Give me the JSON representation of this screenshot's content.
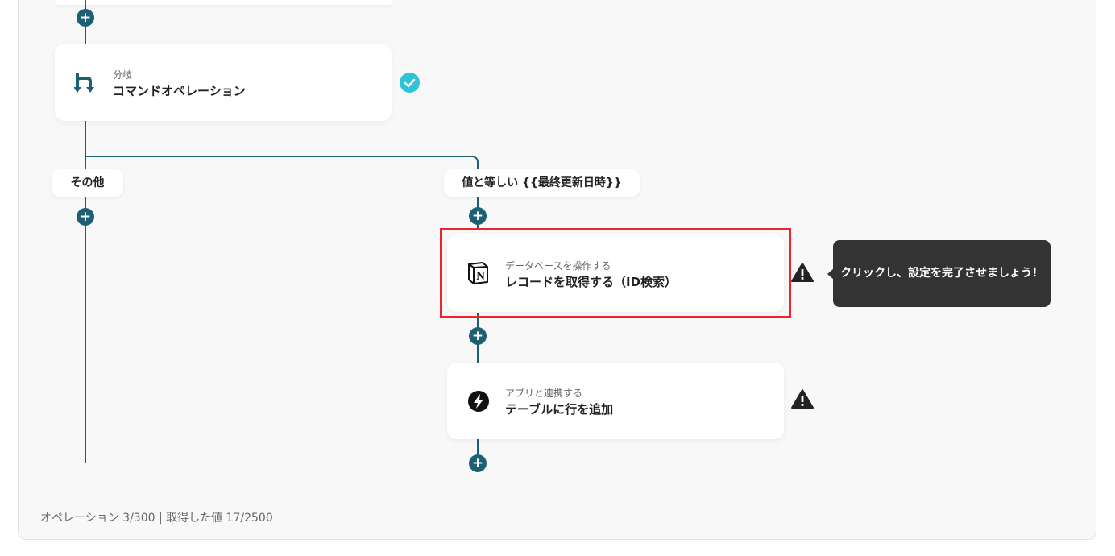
{
  "flow": {
    "branch_card": {
      "subtitle": "分岐",
      "title": "コマンドオペレーション",
      "icon": "branch-icon",
      "status": "completed"
    },
    "branch_labels": {
      "other": "その他",
      "condition": "値と等しい {{最終更新日時}}"
    },
    "notion_card": {
      "subtitle": "データベースを操作する",
      "title": "レコードを取得する（ID検索）",
      "icon": "notion-icon",
      "status": "warning"
    },
    "app_card": {
      "subtitle": "アプリと連携する",
      "title": "テーブルに行を追加",
      "icon": "app-link-icon",
      "status": "warning"
    },
    "tooltip": "クリックし、設定を完了させましょう！",
    "add_button_symbol": "+"
  },
  "footer": {
    "status_text": "オペレーション 3/300 | 取得した値 17/2500"
  },
  "colors": {
    "accent": "#1d5f73",
    "check": "#2ec4d6",
    "highlight": "#e8262b",
    "tooltip_bg": "#333333",
    "canvas_bg": "#f8f8f8"
  }
}
